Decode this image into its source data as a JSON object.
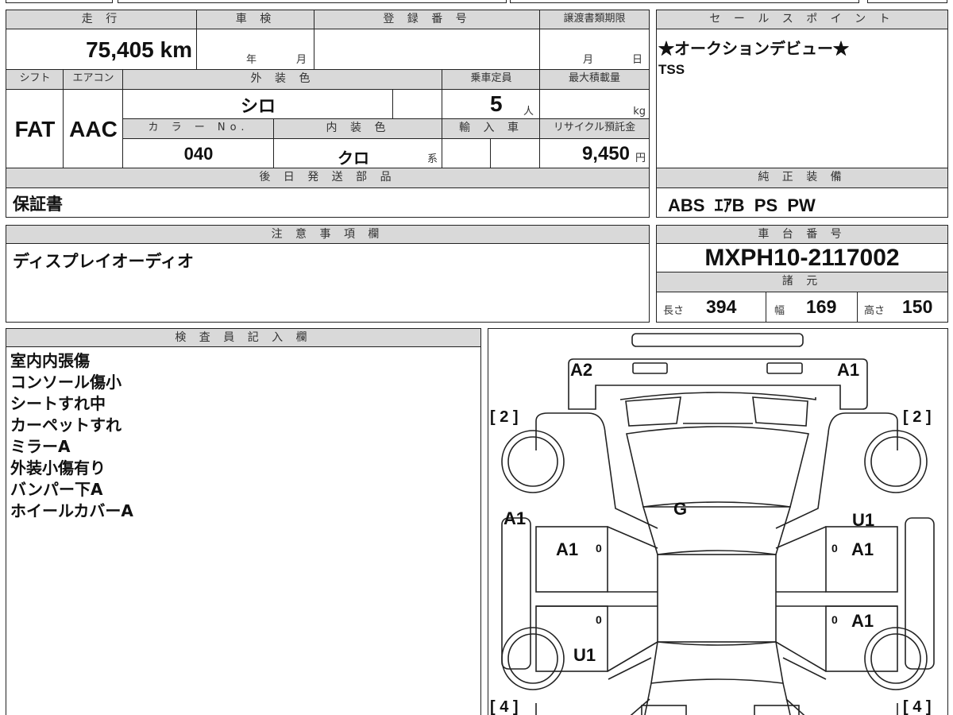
{
  "mileage": {
    "label": "走 行",
    "value": "75,405",
    "unit": "km"
  },
  "shaken": {
    "label": "車 検",
    "year_unit": "年",
    "month_unit": "月"
  },
  "registration": {
    "label": "登 録 番 号",
    "value": ""
  },
  "transfer_deadline": {
    "label": "譲渡書類期限",
    "month_unit": "月",
    "day_unit": "日"
  },
  "shift": {
    "label": "シフト",
    "value": "FAT"
  },
  "aircon": {
    "label": "エアコン",
    "value": "AAC"
  },
  "exterior_color": {
    "label": "外 装 色",
    "value": "シロ"
  },
  "capacity": {
    "label": "乗車定員",
    "value": "5",
    "unit": "人"
  },
  "max_load": {
    "label": "最大積載量",
    "unit": "kg"
  },
  "color_no": {
    "label": "カ ラ ー No.",
    "value": "040"
  },
  "interior_color": {
    "label": "内 装 色",
    "value": "クロ",
    "suffix": "系"
  },
  "import": {
    "label": "輸 入 車"
  },
  "recycle_fee": {
    "label": "リサイクル預託金",
    "value": "9,450",
    "unit": "円"
  },
  "later_parts": {
    "label": "後 日 発 送 部 品",
    "value": "保証書"
  },
  "sales_point": {
    "label": "セ ー ル ス ポ イ ン ト",
    "lines": [
      "★オークションデビュー★",
      "TSS"
    ]
  },
  "equipment": {
    "label": "純 正 装 備",
    "value": "ABS  ｴｱB  PS  PW"
  },
  "notes": {
    "label": "注 意 事 項 欄",
    "value": "ディスプレイオーディオ"
  },
  "chassis": {
    "label": "車 台 番 号",
    "value": "MXPH10-2117002"
  },
  "specs": {
    "label": "諸 元",
    "length_label": "長さ",
    "length": "394",
    "width_label": "幅",
    "width": "169",
    "height_label": "高さ",
    "height": "150"
  },
  "inspector": {
    "label": "検 査 員 記 入 欄",
    "lines": [
      "室内内張傷",
      "コンソール傷小",
      "シートすれ中",
      "カーペットすれ",
      "ミラーA",
      "外装小傷有り",
      "バンパー下A",
      "ホイールカバーA"
    ]
  },
  "diagram": {
    "marks": {
      "front_left": "A2",
      "front_right": "A1",
      "left_pillar": "A1",
      "left_front_door": "A1",
      "hood": "G",
      "right_front_fender": "U1",
      "right_front_door": "A1",
      "right_rear_door": "A1",
      "left_rear_fender": "U1",
      "zero1": "0",
      "zero2": "0",
      "zero3": "0",
      "zero4": "0"
    },
    "tires": {
      "front_left": "[ 2 ]",
      "front_right": "[ 2 ]",
      "rear_left": "[ 4 ]",
      "rear_right": "[ 4 ]"
    }
  }
}
